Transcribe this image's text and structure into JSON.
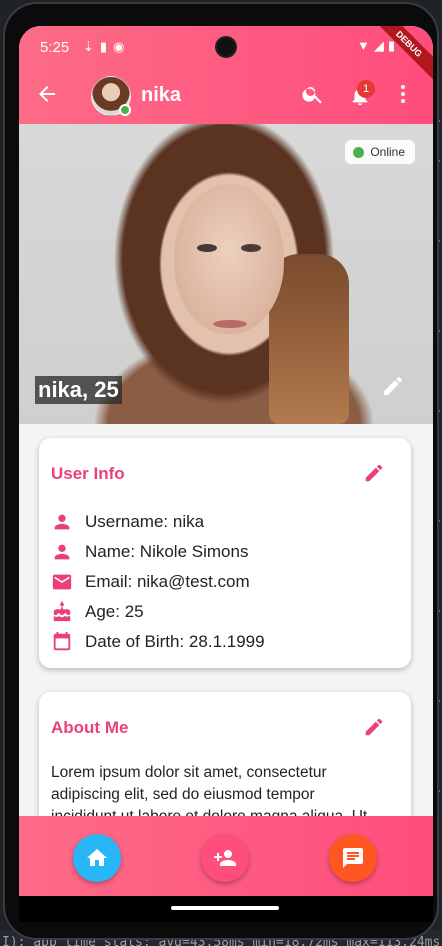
{
  "status_bar": {
    "time": "5:25",
    "left_icons": [
      "download-icon",
      "sd-card-icon",
      "app-icon"
    ],
    "right_icons": [
      "wifi-icon",
      "signal-icon",
      "battery-icon"
    ],
    "debug_banner": "DEBUG"
  },
  "app_bar": {
    "title": "nika",
    "notification_count": "1",
    "colors": {
      "gradient_start": "#fd6b87",
      "gradient_end": "#ff4d7c"
    }
  },
  "hero": {
    "status_chip": "Online",
    "name_age": "nika, 25"
  },
  "user_info": {
    "title": "User Info",
    "rows": [
      {
        "icon": "person-icon",
        "text": "Username: nika"
      },
      {
        "icon": "person-icon",
        "text": "Name: Nikole Simons"
      },
      {
        "icon": "email-icon",
        "text": "Email: nika@test.com"
      },
      {
        "icon": "cake-icon",
        "text": "Age: 25"
      },
      {
        "icon": "calendar-icon",
        "text": "Date of Birth: 28.1.1999"
      }
    ]
  },
  "about_me": {
    "title": "About Me",
    "text": "Lorem ipsum dolor sit amet, consectetur adipiscing elit, sed do eiusmod tempor incididunt ut labore et dolore magna aliqua. Ut"
  },
  "bottom_nav": {
    "items": [
      {
        "icon": "home-icon",
        "color": "#29b6f6"
      },
      {
        "icon": "person-add-icon",
        "color": "#ff4d7c"
      },
      {
        "icon": "chat-icon",
        "color": "#ff5722"
      }
    ]
  },
  "ide": {
    "console_text": "I): app time stats: avg=43.58ms min=18.72ms max=113.24ms"
  },
  "colors": {
    "accent": "#ea3f7b",
    "online": "#4caf50",
    "badge": "#e53935"
  }
}
